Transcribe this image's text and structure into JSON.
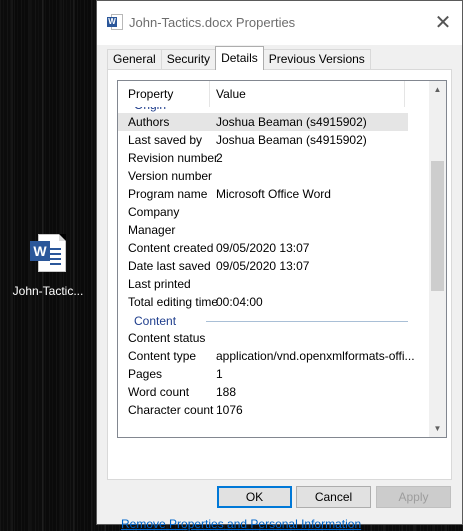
{
  "desktop": {
    "file_icon": "word-document-icon",
    "file_label": "John-Tactic..."
  },
  "dialog": {
    "title": "John-Tactics.docx Properties",
    "title_icon": "word-document-icon",
    "close_glyph": "✕",
    "tabs": [
      {
        "label": "General",
        "active": false
      },
      {
        "label": "Security",
        "active": false
      },
      {
        "label": "Details",
        "active": true
      },
      {
        "label": "Previous Versions",
        "active": false
      }
    ],
    "columns": {
      "property": "Property",
      "value": "Value"
    },
    "groups": {
      "origin": "Origin",
      "content": "Content"
    },
    "origin_rows": [
      {
        "key": "Authors",
        "value": "Joshua Beaman (s4915902)"
      },
      {
        "key": "Last saved by",
        "value": "Joshua Beaman (s4915902)"
      },
      {
        "key": "Revision number",
        "value": "2"
      },
      {
        "key": "Version number",
        "value": ""
      },
      {
        "key": "Program name",
        "value": "Microsoft Office Word"
      },
      {
        "key": "Company",
        "value": ""
      },
      {
        "key": "Manager",
        "value": ""
      },
      {
        "key": "Content created",
        "value": "09/05/2020 13:07"
      },
      {
        "key": "Date last saved",
        "value": "09/05/2020 13:07"
      },
      {
        "key": "Last printed",
        "value": ""
      },
      {
        "key": "Total editing time",
        "value": "00:04:00"
      }
    ],
    "content_rows": [
      {
        "key": "Content status",
        "value": ""
      },
      {
        "key": "Content type",
        "value": "application/vnd.openxmlformats-offi..."
      },
      {
        "key": "Pages",
        "value": "1"
      },
      {
        "key": "Word count",
        "value": "188"
      },
      {
        "key": "Character count",
        "value": "1076"
      }
    ],
    "remove_link": "Remove Properties and Personal Information",
    "buttons": {
      "ok": "OK",
      "cancel": "Cancel",
      "apply": "Apply"
    },
    "colors": {
      "accent": "#0078d7",
      "group_header": "#1e3d8c",
      "link": "#0066cc",
      "word_blue": "#2b579a"
    }
  }
}
